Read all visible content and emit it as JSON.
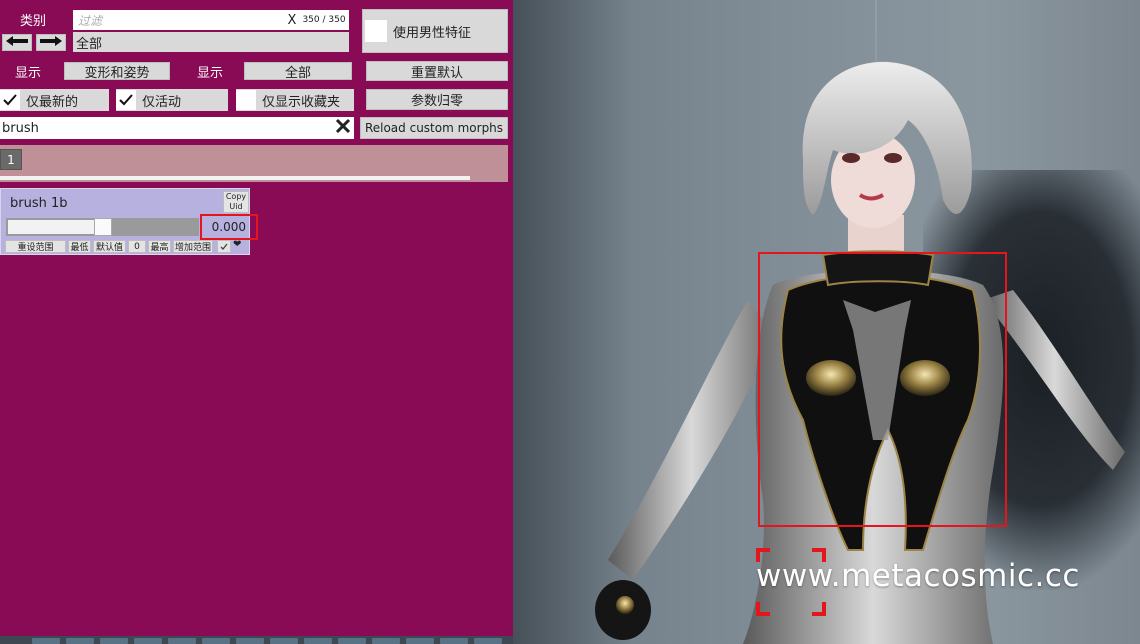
{
  "panel": {
    "category_label": "类别",
    "filter_placeholder": "过滤",
    "filter_clear": "X",
    "filter_count": "350 / 350",
    "category_value": "全部",
    "use_male_features": "使用男性特征",
    "show_label_1": "显示",
    "show_value_1": "变形和姿势",
    "show_label_2": "显示",
    "show_value_2": "全部",
    "reset_default": "重置默认",
    "params_zero": "参数归零",
    "latest_only": "仅最新的",
    "active_only": "仅活动",
    "favorites_only": "仅显示收藏夹",
    "search_value": "brush",
    "reload_morphs": "Reload custom morphs",
    "page_number": "1"
  },
  "morph": {
    "name": "brush 1b",
    "copy_uid_line1": "Copy",
    "copy_uid_line2": "Uid",
    "value": "0.000",
    "slider_level": 0.0,
    "reset_range": "重设范围",
    "min": "最低",
    "default": "默认值",
    "zero": "0",
    "max": "最高",
    "increase_range": "增加范围"
  },
  "viewport": {
    "watermark": "www.metacosmic.cc"
  },
  "colors": {
    "panel_bg": "#8a0b55",
    "highlight": "#e2161c",
    "card_bg": "#b7b1df"
  }
}
